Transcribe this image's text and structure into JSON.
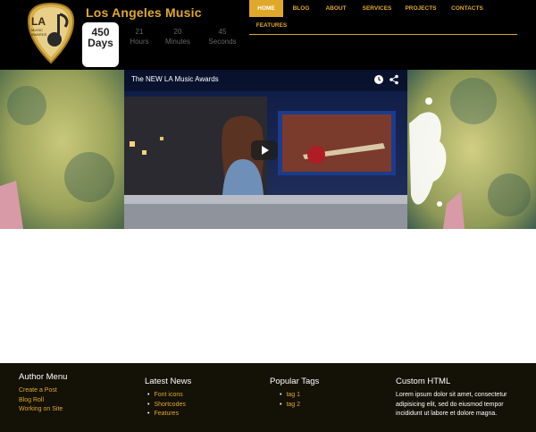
{
  "site": {
    "title": "Los Angeles Music"
  },
  "countdown": {
    "days_value": "450",
    "days_label": "Days",
    "hours_value": "21",
    "hours_label": "Hours",
    "minutes_value": "20",
    "minutes_label": "Minutes",
    "seconds_value": "45",
    "seconds_label": "Seconds"
  },
  "nav": {
    "items": [
      {
        "label": "HOME"
      },
      {
        "label": "BLOG"
      },
      {
        "label": "ABOUT"
      },
      {
        "label": "SERVICES"
      },
      {
        "label": "PROJECTS"
      },
      {
        "label": "CONTACTS"
      },
      {
        "label": "FEATURES"
      }
    ]
  },
  "video": {
    "title": "The NEW LA Music Awards"
  },
  "footer": {
    "author_menu": {
      "title": "Author Menu",
      "links": [
        "Create a Post",
        "Blog Roll",
        "Working on Site"
      ]
    },
    "latest_news": {
      "title": "Latest News",
      "items": [
        "Font icons",
        "Shortcodes",
        "Features"
      ]
    },
    "popular_tags": {
      "title": "Popular Tags",
      "items": [
        "tag 1",
        "tag 2"
      ]
    },
    "custom_html": {
      "title": "Custom HTML",
      "text": "Lorem ipsum dolor sit amet, consectetur adipisicing elit, sed do eiusmod tempor incididunt ut labore et dolore magna."
    }
  },
  "colors": {
    "accent": "#e0a82b",
    "header_bg": "#000000",
    "footer_bg": "#141106",
    "video_bg": "#1a2b55"
  }
}
